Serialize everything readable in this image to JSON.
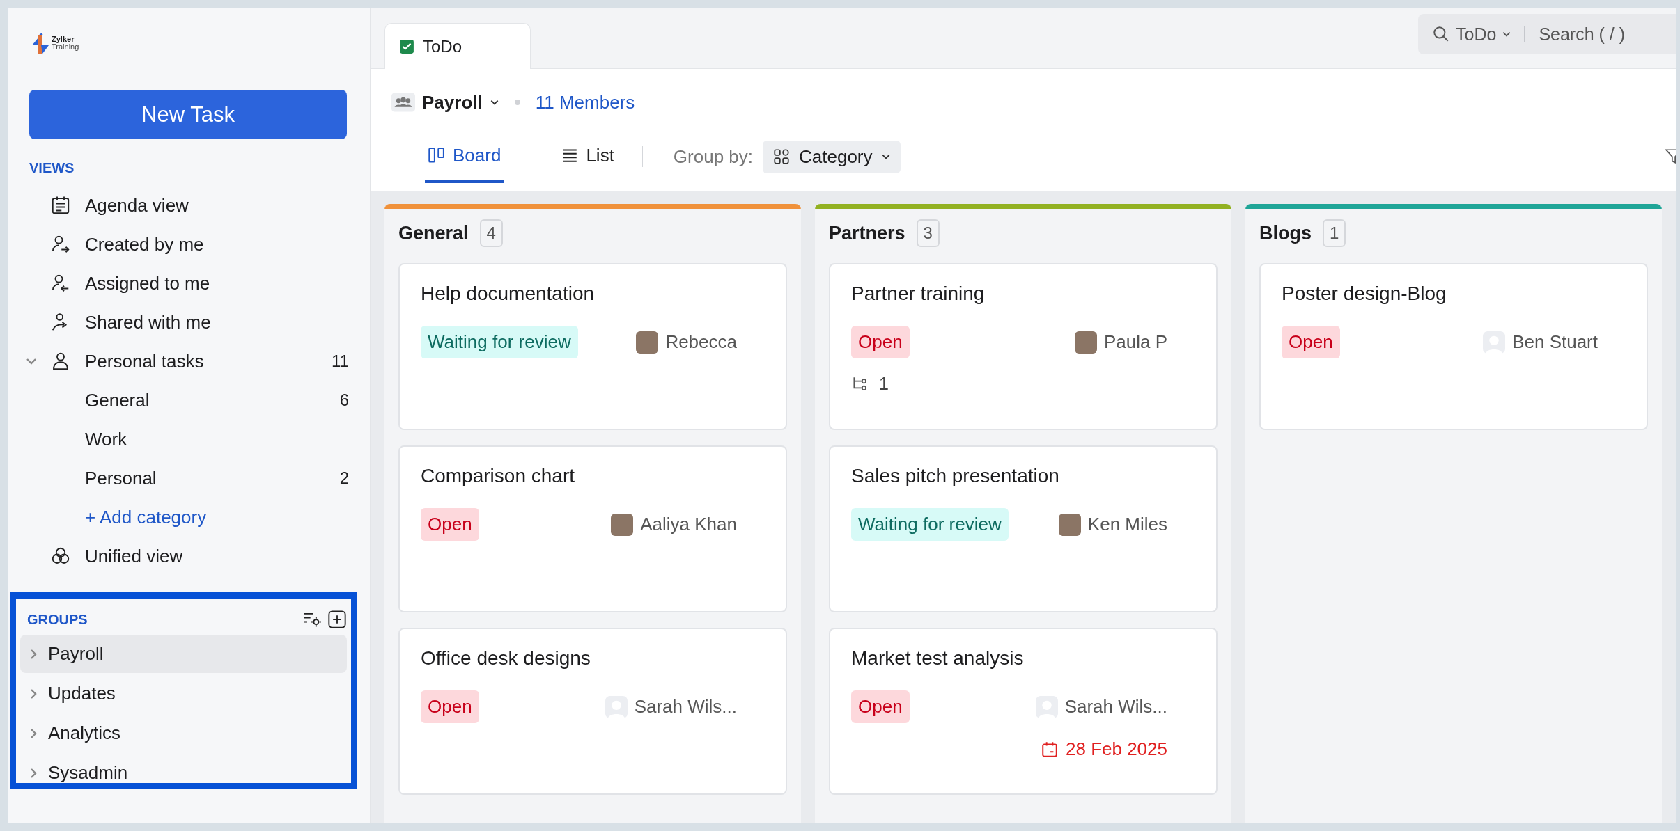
{
  "logo": {
    "name": "Zylker",
    "subtitle": "Training"
  },
  "new_task_button": "New Task",
  "views": {
    "heading": "VIEWS",
    "items": [
      {
        "label": "Agenda view"
      },
      {
        "label": "Created by me"
      },
      {
        "label": "Assigned to me"
      },
      {
        "label": "Shared with me"
      },
      {
        "label": "Personal tasks",
        "count": "11",
        "expanded": true,
        "children": [
          {
            "label": "General",
            "count": "6"
          },
          {
            "label": "Work"
          },
          {
            "label": "Personal",
            "count": "2"
          }
        ],
        "add_link": "+ Add category"
      },
      {
        "label": "Unified view"
      }
    ]
  },
  "groups": {
    "heading": "GROUPS",
    "items": [
      {
        "label": "Payroll",
        "selected": true,
        "expanded": false
      },
      {
        "label": "Updates",
        "selected": false,
        "expanded": false
      },
      {
        "label": "Analytics",
        "selected": false,
        "expanded": false
      },
      {
        "label": "Sysadmin",
        "selected": false,
        "expanded": false
      }
    ]
  },
  "tab": {
    "label": "ToDo"
  },
  "search": {
    "scope": "ToDo",
    "placeholder": "Search ( / )"
  },
  "group_header": {
    "name": "Payroll",
    "members": "11 Members"
  },
  "view_tabs": [
    {
      "label": "Board",
      "selected": true
    },
    {
      "label": "List",
      "selected": false
    }
  ],
  "group_by": {
    "label": "Group by:",
    "value": "Category"
  },
  "columns": [
    {
      "title": "General",
      "count": "4",
      "color": "#f0913a",
      "cards": [
        {
          "title": "Help documentation",
          "status": {
            "label": "Waiting for review",
            "kind": "review"
          },
          "assignee": {
            "name": "Rebecca",
            "has_photo": true
          }
        },
        {
          "title": "Comparison chart",
          "status": {
            "label": "Open",
            "kind": "open"
          },
          "assignee": {
            "name": "Aaliya Khan",
            "has_photo": true
          }
        },
        {
          "title": "Office desk designs",
          "status": {
            "label": "Open",
            "kind": "open"
          },
          "assignee": {
            "name": "Sarah Wils...",
            "has_photo": false
          }
        }
      ]
    },
    {
      "title": "Partners",
      "count": "3",
      "color": "#92b121",
      "cards": [
        {
          "title": "Partner training",
          "status": {
            "label": "Open",
            "kind": "open"
          },
          "assignee": {
            "name": "Paula P",
            "has_photo": true
          },
          "subtasks": "1"
        },
        {
          "title": "Sales pitch presentation",
          "status": {
            "label": "Waiting for review",
            "kind": "review"
          },
          "assignee": {
            "name": "Ken Miles",
            "has_photo": true
          }
        },
        {
          "title": "Market test analysis",
          "status": {
            "label": "Open",
            "kind": "open"
          },
          "assignee": {
            "name": "Sarah Wils...",
            "has_photo": false
          },
          "due_date": "28 Feb 2025"
        }
      ]
    },
    {
      "title": "Blogs",
      "count": "1",
      "color": "#1fa597",
      "cards": [
        {
          "title": "Poster design-Blog",
          "status": {
            "label": "Open",
            "kind": "open"
          },
          "assignee": {
            "name": "Ben Stuart",
            "has_photo": false
          }
        }
      ]
    }
  ]
}
